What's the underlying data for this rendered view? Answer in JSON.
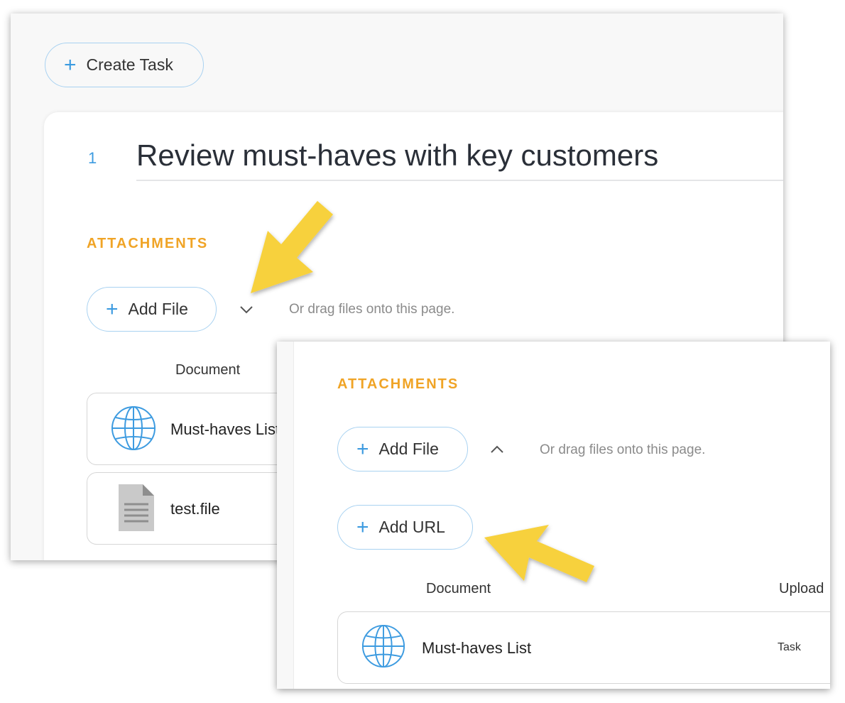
{
  "back": {
    "create_task_label": "Create Task",
    "task_number": "1",
    "task_title": "Review must-haves with key customers",
    "attachments_label": "ATTACHMENTS",
    "add_file_label": "Add File",
    "drag_hint": "Or drag files onto this page.",
    "column_document": "Document",
    "rows": [
      {
        "name": "Must-haves List",
        "icon": "globe-icon"
      },
      {
        "name": "test.file",
        "icon": "document-icon"
      }
    ]
  },
  "front": {
    "attachments_label": "ATTACHMENTS",
    "add_file_label": "Add File",
    "drag_hint": "Or drag files onto this page.",
    "add_url_label": "Add URL",
    "column_document": "Document",
    "column_upload": "Upload",
    "rows": [
      {
        "name": "Must-haves List",
        "meta": "Task",
        "icon": "globe-icon"
      }
    ]
  },
  "colors": {
    "accent_blue": "#3d9be0",
    "pill_border": "#a9d2f1",
    "section_orange": "#f0a426",
    "arrow_yellow": "#f7d13d"
  }
}
